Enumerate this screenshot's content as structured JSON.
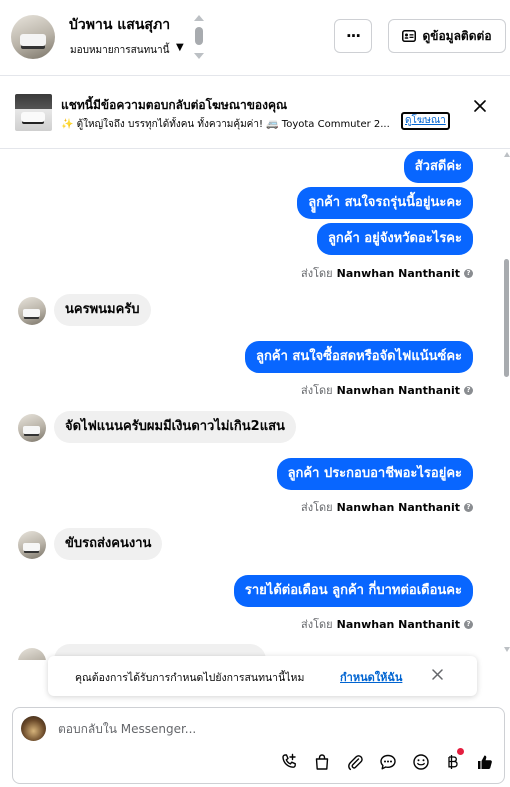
{
  "header": {
    "name": "บัวพาน แสนสุภา",
    "subtitle": "มอบหมายการสนทนานี้",
    "more_label": "···",
    "contact_label": "ดูข้อมูลติดต่อ"
  },
  "ad": {
    "title": "แชทนี้มีข้อความตอบกลับต่อโฆษณาของคุณ",
    "description": "✨ ตู้ใหญ่ใจถึง บรรทุกได้ทั้งคน ทั้งความคุ้มค่า! 🚐 Toyota Commuter 2...",
    "link_label": "ดูโฆษณา",
    "close_icon": "close-icon"
  },
  "messages": [
    {
      "dir": "out",
      "text": "สัวสดีค่ะ"
    },
    {
      "dir": "out",
      "text": "ลููกค้า สนใจรถรุ่นนี้อยู่นะคะ"
    },
    {
      "dir": "out",
      "text": "ลูกค้า อยู่จังหวัดอะไรคะ"
    },
    {
      "dir": "sent",
      "prefix": "ส่งโดย",
      "name": "Nanwhan Nanthanit"
    },
    {
      "dir": "in",
      "text": "นครพนมครับ"
    },
    {
      "dir": "out",
      "text": "ลูกค้า สนใจซื้อสดหรือจัดไฟแน้นซ์คะ"
    },
    {
      "dir": "sent",
      "prefix": "ส่งโดย",
      "name": "Nanwhan Nanthanit"
    },
    {
      "dir": "in",
      "text": "จัดไฟแนนครับผมมีเงินดาวไม่เกิน2แสน"
    },
    {
      "dir": "out",
      "text": "ลูกค้า ประกอบอาชีพอะไรอยู่คะ"
    },
    {
      "dir": "sent",
      "prefix": "ส่งโดย",
      "name": "Nanwhan Nanthanit"
    },
    {
      "dir": "in",
      "text": "ขับรถส่งคนงาน"
    },
    {
      "dir": "out",
      "text": "รายได้ต่อเดือน  ลูกค้า กี่บาทต่อเดือนคะ"
    },
    {
      "dir": "sent",
      "prefix": "ส่งโดย",
      "name": "Nanwhan Nanthanit"
    }
  ],
  "toast": {
    "text": "คุณต้องการได้รับการกำหนดไปยังการสนทนานี้ไหม",
    "link": "กำหนดให้ฉัน"
  },
  "composer": {
    "placeholder": "ตอบกลับใน Messenger...",
    "tools": [
      "call-add-icon",
      "shopping-bag-icon",
      "paperclip-icon",
      "saved-reply-icon",
      "emoji-icon",
      "baht-payment-icon",
      "like-icon"
    ]
  },
  "colors": {
    "outgoing_bubble": "#0866ff",
    "incoming_bubble": "#f0f0f0",
    "link": "#0064d1"
  }
}
